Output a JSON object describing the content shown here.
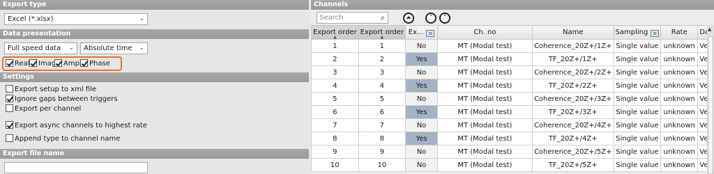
{
  "export_type": {
    "header": "Export type",
    "format": "Excel (*.xlsx)"
  },
  "data_presentation": {
    "header": "Data presentation",
    "speed": "Full speed data",
    "time": "Absolute time",
    "components": [
      {
        "label": "Real",
        "checked": true
      },
      {
        "label": "Imag",
        "checked": true
      },
      {
        "label": "Ampl",
        "checked": true
      },
      {
        "label": "Phase",
        "checked": true
      }
    ]
  },
  "settings": {
    "header": "Settings",
    "options": [
      {
        "label": "Export setup to xml file",
        "checked": false
      },
      {
        "label": "Ignore gaps between triggers",
        "checked": true
      },
      {
        "label": "Export per channel",
        "checked": false
      },
      {
        "label": "Export async channels to highest rate",
        "checked": true
      },
      {
        "label": "Append type to channel name",
        "checked": false
      }
    ]
  },
  "export_file_name": {
    "header": "Export file name",
    "value": ""
  },
  "channels": {
    "header": "Channels",
    "search_placeholder": "Search",
    "columns": [
      "Export order",
      "Export order",
      "Ex...",
      "Ch. no",
      "Name",
      "Sampling",
      "Rate",
      "Dat"
    ],
    "rows": [
      {
        "o1": "1",
        "o2": "1",
        "ex": "No",
        "ch": "MT (Modal test)",
        "name": "Coherence_20Z+/1Z+",
        "sampling": "Single value",
        "rate": "unknown",
        "dat": "Vec"
      },
      {
        "o1": "2",
        "o2": "2",
        "ex": "Yes",
        "ch": "MT (Modal test)",
        "name": "TF_20Z+/1Z+",
        "sampling": "Single value",
        "rate": "unknown",
        "dat": "Vec"
      },
      {
        "o1": "3",
        "o2": "3",
        "ex": "No",
        "ch": "MT (Modal test)",
        "name": "Coherence_20Z+/2Z+",
        "sampling": "Single value",
        "rate": "unknown",
        "dat": "Vec"
      },
      {
        "o1": "4",
        "o2": "4",
        "ex": "Yes",
        "ch": "MT (Modal test)",
        "name": "TF_20Z+/2Z+",
        "sampling": "Single value",
        "rate": "unknown",
        "dat": "Vec"
      },
      {
        "o1": "5",
        "o2": "5",
        "ex": "No",
        "ch": "MT (Modal test)",
        "name": "Coherence_20Z+/3Z+",
        "sampling": "Single value",
        "rate": "unknown",
        "dat": "Vec"
      },
      {
        "o1": "6",
        "o2": "6",
        "ex": "Yes",
        "ch": "MT (Modal test)",
        "name": "TF_20Z+/3Z+",
        "sampling": "Single value",
        "rate": "unknown",
        "dat": "Vec"
      },
      {
        "o1": "7",
        "o2": "7",
        "ex": "No",
        "ch": "MT (Modal test)",
        "name": "Coherence_20Z+/4Z+",
        "sampling": "Single value",
        "rate": "unknown",
        "dat": "Vec"
      },
      {
        "o1": "8",
        "o2": "8",
        "ex": "Yes",
        "ch": "MT (Modal test)",
        "name": "TF_20Z+/4Z+",
        "sampling": "Single value",
        "rate": "unknown",
        "dat": "Vec"
      },
      {
        "o1": "9",
        "o2": "9",
        "ex": "No",
        "ch": "MT (Modal test)",
        "name": "Coherence_20Z+/5Z+",
        "sampling": "Single value",
        "rate": "unknown",
        "dat": "Vec"
      },
      {
        "o1": "10",
        "o2": "10",
        "ex": "No",
        "ch": "MT (Modal test)",
        "name": "TF_20Z+/5Z+",
        "sampling": "Single value",
        "rate": "unknown",
        "dat": "Vec"
      }
    ]
  },
  "colors": {
    "highlight": "#e8732a",
    "yes_cell": "#a4b2c6",
    "section_header": "#a0a0a0"
  }
}
